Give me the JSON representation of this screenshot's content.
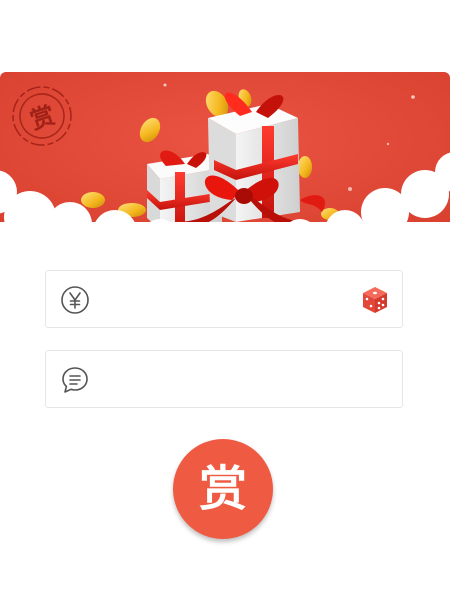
{
  "banner": {
    "stamp_text": "赏",
    "background_color": "#e2493a",
    "illustration": "gift-boxes-with-coins"
  },
  "amount_field": {
    "icon": "yen-circle-icon",
    "value": "",
    "placeholder": "",
    "random_icon": "dice-icon"
  },
  "message_field": {
    "icon": "chat-bubble-icon",
    "value": "",
    "placeholder": ""
  },
  "reward_button": {
    "label": "赏",
    "color": "#ef5a43"
  }
}
